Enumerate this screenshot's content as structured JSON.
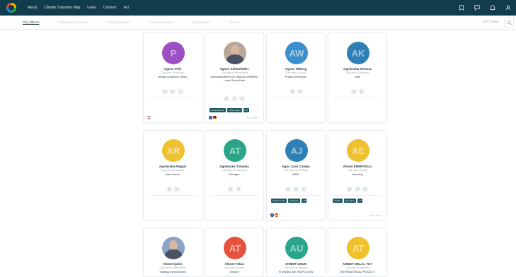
{
  "nav": {
    "items": [
      "About",
      "Climate Transition Map",
      "Learn",
      "Connect",
      "Act"
    ]
  },
  "tabs": [
    {
      "label": "City officers",
      "active": true
    },
    {
      "label": "Public authority users",
      "active": false
    },
    {
      "label": "City practitioners",
      "active": false
    },
    {
      "label": "Community users",
      "active": false
    },
    {
      "label": "City advisors",
      "active": false
    },
    {
      "label": "All users",
      "active": false
    }
  ],
  "users_count": "2577 Users",
  "icons": {
    "logo": "circle-logo",
    "top": [
      "bookmark-icon",
      "chat-icon",
      "bell-icon",
      "user-icon"
    ],
    "search": "search-icon"
  },
  "colors": {
    "topbar": "#113c4b",
    "tag": "#1f5a63",
    "purple": "#9b4fc2",
    "blue": "#3b8fcc",
    "yellow": "#f0c12e",
    "green": "#2aa58a",
    "red": "#e5533f"
  },
  "cards": [
    {
      "initials": "P",
      "name": "Agnes Pelé",
      "city": "City user of Miskolc",
      "role": "climate protection officer",
      "avatar_color": "#9b4fc2",
      "actions": 3,
      "tags": [],
      "flags": [
        "hu"
      ],
      "see_more": ""
    },
    {
      "initials": "",
      "photo": true,
      "name": "Agnes Schönfelder",
      "city": "City user of Mannheim",
      "role": "Sachbearbeiterin EU Mission/URBINNO Local Green Deal",
      "avatar_color": "#b9a89a",
      "actions": 3,
      "tags": [
        "Renewable en",
        "Urban plann",
        "ICT"
      ],
      "flags": [
        "gb",
        "de"
      ],
      "see_more": "See more"
    },
    {
      "initials": "AW",
      "name": "Agnes Wiberg",
      "city": "City user of Lund",
      "role": "Project Developer",
      "avatar_color": "#3b8fcc",
      "actions": 2,
      "tags": [],
      "flags": [],
      "see_more": ""
    },
    {
      "initials": "AK",
      "name": "Agnieszka Kleszcz",
      "city": "City user of Krakow",
      "role": "clerk",
      "avatar_color": "#2e7fb6",
      "actions": 2,
      "tags": [],
      "flags": [],
      "see_more": ""
    },
    {
      "initials": "AR",
      "name": "Agnieszka Rogala",
      "city": "City user of Warsaw",
      "role": "team leader",
      "avatar_color": "#f0c12e",
      "actions": 2,
      "tags": [],
      "flags": [],
      "see_more": ""
    },
    {
      "initials": "AT",
      "name": "Agnieszka Tomalas",
      "city": "City user of Rzeszów",
      "role": "Manager",
      "avatar_color": "#2aa58a",
      "actions": 2,
      "tags": [],
      "flags": [],
      "see_more": ""
    },
    {
      "initials": "AJ",
      "name": "Agus Juan Campa",
      "city": "City user of La Rioja",
      "role": "ADDL",
      "avatar_color": "#2e7fb6",
      "actions": 3,
      "tags": [
        "Circular econ",
        "Education",
        "+8"
      ],
      "flags": [
        "gb",
        "es"
      ],
      "see_more": ""
    },
    {
      "initials": "AE",
      "name": "Ahmet ENEROĞLU",
      "city": "City user of Bolu",
      "role": "Arkeolog",
      "avatar_color": "#f0c12e",
      "actions": 3,
      "tags": [
        "Culture",
        "Education",
        "+7"
      ],
      "flags": [],
      "see_more": "See more"
    },
    {
      "initials": "",
      "photo": true,
      "name": "Ahmet Şahin",
      "city": "City user of Bandırma",
      "role": "Strategy Development",
      "avatar_color": "#8aa2c3",
      "actions": 0,
      "tags": [],
      "flags": [],
      "see_more": ""
    },
    {
      "initials": "AT",
      "name": "Ahmet Tokar",
      "city": "City user of İzmir",
      "role": "Director",
      "avatar_color": "#e5533f",
      "actions": 0,
      "tags": [],
      "flags": [],
      "see_more": ""
    },
    {
      "initials": "AU",
      "name": "AHMET URUN",
      "city": "City user of Istanbul",
      "role": "İSTANBUL METROPOLİTAN",
      "avatar_color": "#2aa58a",
      "actions": 0,
      "tags": [],
      "flags": [],
      "see_more": ""
    },
    {
      "initials": "AT",
      "name": "AHMET DELAL TUY",
      "city": "City user of Istanbul",
      "role": "INTERNATIONAL PROJECT",
      "avatar_color": "#f0c12e",
      "actions": 0,
      "tags": [],
      "flags": [],
      "see_more": ""
    }
  ]
}
